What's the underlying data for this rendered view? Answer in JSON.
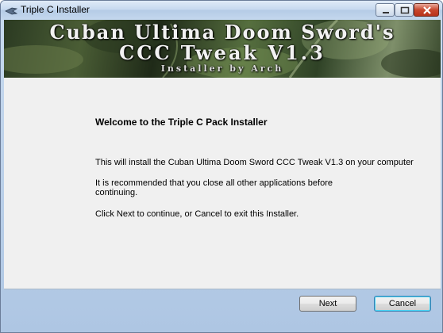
{
  "window": {
    "title": "Triple C Installer"
  },
  "banner": {
    "line1": "Cuban Ultima Doom Sword's",
    "line2": "CCC Tweak V1.3",
    "line3": "Installer by Arch"
  },
  "content": {
    "heading": "Welcome to the Triple C Pack Installer",
    "paragraph1": "This will install the Cuban Ultima Doom Sword CCC Tweak V1.3 on your computer",
    "paragraph2": "It is recommended that you close all other applications before continuing.",
    "paragraph3": "Click Next to continue, or Cancel to exit this Installer."
  },
  "buttons": {
    "next": "Next",
    "cancel": "Cancel"
  },
  "icons": {
    "app": "installer-icon",
    "minimize": "minimize-icon",
    "maximize": "maximize-icon",
    "close": "close-icon"
  }
}
